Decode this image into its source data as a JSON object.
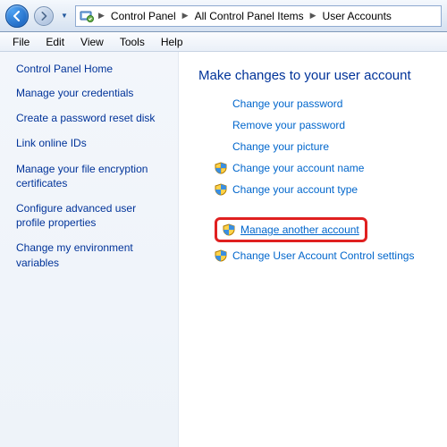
{
  "breadcrumb": {
    "items": [
      "Control Panel",
      "All Control Panel Items",
      "User Accounts"
    ]
  },
  "menu": {
    "items": [
      "File",
      "Edit",
      "View",
      "Tools",
      "Help"
    ]
  },
  "sidebar": {
    "heading": "Control Panel Home",
    "links": [
      "Manage your credentials",
      "Create a password reset disk",
      "Link online IDs",
      "Manage your file encryption certificates",
      "Configure advanced user profile properties",
      "Change my environment variables"
    ]
  },
  "main": {
    "heading": "Make changes to your user account",
    "actions_plain": [
      "Change your password",
      "Remove your password",
      "Change your picture"
    ],
    "actions_shield": [
      "Change your account name",
      "Change your account type"
    ],
    "action_highlight": "Manage another account",
    "action_uac": "Change User Account Control settings"
  }
}
